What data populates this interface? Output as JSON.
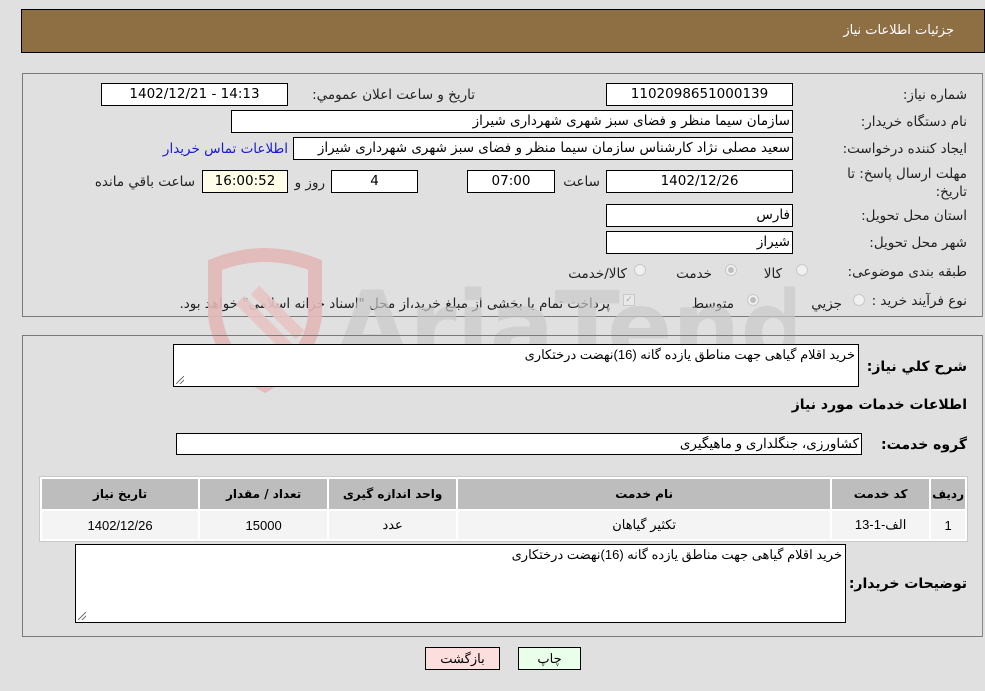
{
  "header": {
    "title": "جزئیات اطلاعات نیاز"
  },
  "fields": {
    "need_number": {
      "label": "شماره نیاز:",
      "value": "1102098651000139"
    },
    "announce_datetime": {
      "label": "تاریخ و ساعت اعلان عمومي:",
      "value": "1402/12/21 - 14:13"
    },
    "buyer_org": {
      "label": "نام دستگاه خریدار:",
      "value": "سازمان سیما منظر و فضای سبز شهری شهرداری شیراز"
    },
    "requester": {
      "label": "ایجاد کننده درخواست:",
      "value": "سعید مصلی نژاد کارشناس سازمان سیما منظر و فضای سبز شهری شهرداری شیراز"
    },
    "buyer_contact_link": "اطلاعات تماس خریدار",
    "deadline": {
      "label": "مهلت ارسال پاسخ: تا تاریخ:",
      "date": "1402/12/26",
      "time_label": "ساعت",
      "time": "07:00",
      "days": "4",
      "days_label": "روز و",
      "remaining": "16:00:52",
      "remaining_label": "ساعت باقي مانده"
    },
    "province": {
      "label": "استان محل تحویل:",
      "value": "فارس"
    },
    "city": {
      "label": "شهر محل تحویل:",
      "value": "شیراز"
    },
    "category": {
      "label": "طبقه بندی موضوعی:",
      "options": [
        "کالا",
        "خدمت",
        "کالا/خدمت"
      ],
      "selected": "خدمت"
    },
    "purchase_type": {
      "label": "نوع فرآیند خرید :",
      "options": [
        "جزيي",
        "متوسط"
      ],
      "selected": "متوسط",
      "treasury_note": "پرداخت تمام یا بخشی از مبلغ خرید،از محل \"اسناد خزانه اسلامی\" خواهد بود.",
      "treasury_checked": true
    }
  },
  "general_desc": {
    "label": "شرح کلي نیاز:",
    "value": "خرید اقلام گیاهی جهت مناطق یازده گانه (16)نهضت درختکاری"
  },
  "services_title": "اطلاعات خدمات مورد نیاز",
  "service_group": {
    "label": "گروه خدمت:",
    "value": "کشاورزی، جنگلداری و ماهیگیری"
  },
  "table": {
    "headers": [
      "ردیف",
      "کد خدمت",
      "نام خدمت",
      "واحد اندازه گیری",
      "تعداد / مقدار",
      "تاریخ نیاز"
    ],
    "rows": [
      [
        "1",
        "الف-1-13",
        "تکثیر گیاهان",
        "عدد",
        "15000",
        "1402/12/26"
      ]
    ]
  },
  "buyer_notes": {
    "label": "توضیحات خریدار:",
    "value": "خرید اقلام گیاهی جهت مناطق یازده گانه (16)نهضت درختکاری"
  },
  "buttons": {
    "print": "چاپ",
    "back": "بازگشت"
  },
  "watermark": {
    "text": "AriaTender.neT"
  }
}
